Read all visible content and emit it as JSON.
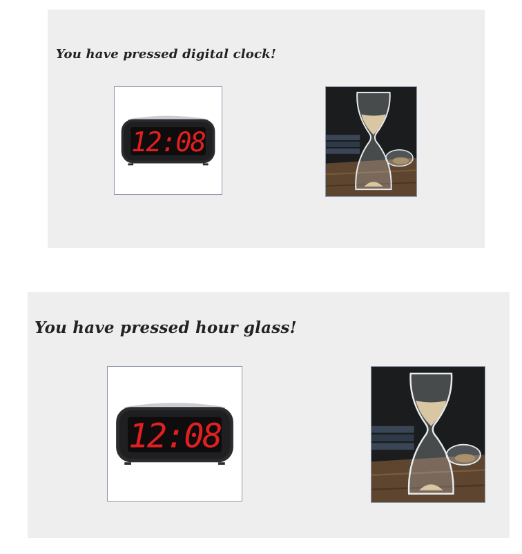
{
  "panel_top": {
    "message": "You have pressed digital clock!",
    "buttons": {
      "clock_icon": "digital-clock-icon",
      "hourglass_icon": "hourglass-icon"
    }
  },
  "panel_bottom": {
    "message": "You have pressed hour glass!",
    "buttons": {
      "clock_icon": "digital-clock-icon",
      "hourglass_icon": "hourglass-icon"
    }
  },
  "clock_display": {
    "time_text": "12:08",
    "digit_color": "#e02020"
  },
  "colors": {
    "panel_bg": "#eeeeee",
    "button_border": "#8c97aa",
    "message_text": "#222222"
  }
}
